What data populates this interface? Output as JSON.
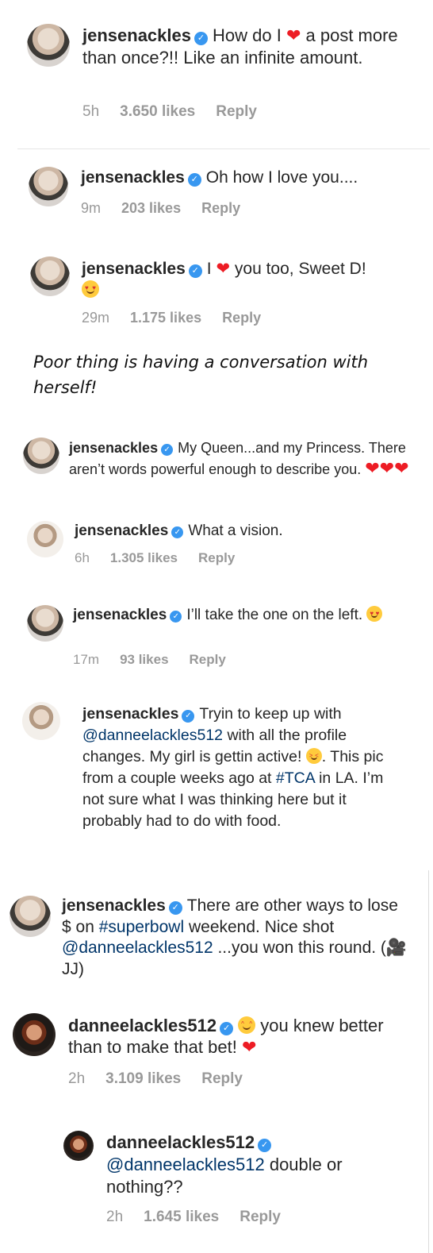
{
  "comments": [
    {
      "user": "jensenackles",
      "text_a": "How do I",
      "text_b": "a post more than once?!! Like an infinite amount.",
      "time": "5h",
      "likes": "3.650 likes",
      "reply": "Reply"
    },
    {
      "user": "jensenackles",
      "text": "Oh how I love you....",
      "time": "9m",
      "likes": "203 likes",
      "reply": "Reply"
    },
    {
      "user": "jensenackles",
      "text_a": "I",
      "text_b": "you too, Sweet D!",
      "time": "29m",
      "likes": "1.175 likes",
      "reply": "Reply"
    },
    {
      "user": "jensenackles",
      "text": "My Queen...and my Princess. There aren’t words powerful enough to describe you."
    },
    {
      "user": "jensenackles",
      "text": "What a vision.",
      "time": "6h",
      "likes": "1.305 likes",
      "reply": "Reply"
    },
    {
      "user": "jensenackles",
      "text": "I’ll take the one on the left.",
      "time": "17m",
      "likes": "93 likes",
      "reply": "Reply"
    },
    {
      "user": "jensenackles",
      "text_a": "Tryin to keep up with",
      "mention": "@danneelackles512",
      "text_b": "with all the profile changes. My girl is gettin active!",
      "text_c": ". This pic from a couple weeks ago at",
      "hashtag": "#TCA",
      "text_d": "in LA. I’m not sure what I was thinking here but it probably had to do with food."
    },
    {
      "user": "jensenackles",
      "text_a": "There are other ways to lose $ on",
      "hashtag": "#superbowl",
      "text_b": "weekend.  Nice shot",
      "mention": "@danneelackles512",
      "text_c": "...you won this round. (",
      "text_d": " JJ)"
    },
    {
      "user": "danneelackles512",
      "text": "you knew better than to make that bet!",
      "time": "2h",
      "likes": "3.109 likes",
      "reply": "Reply"
    },
    {
      "user": "danneelackles512",
      "mention": "@danneelackles512",
      "text": "double or nothing??",
      "time": "2h",
      "likes": "1.645 likes",
      "reply": "Reply"
    }
  ],
  "caption": "Poor thing is having a conversation with herself!",
  "icons": {
    "verified": "verified-badge-icon",
    "heart": "red-heart-emoji",
    "heart_eyes": "heart-eyes-emoji",
    "tongue": "winking-tongue-emoji",
    "rofl": "rolling-laughing-emoji",
    "camera": "movie-camera-emoji"
  },
  "colors": {
    "verified": "#3897f0",
    "meta": "#999999",
    "link": "#003569",
    "heart": "#ed1c24"
  }
}
